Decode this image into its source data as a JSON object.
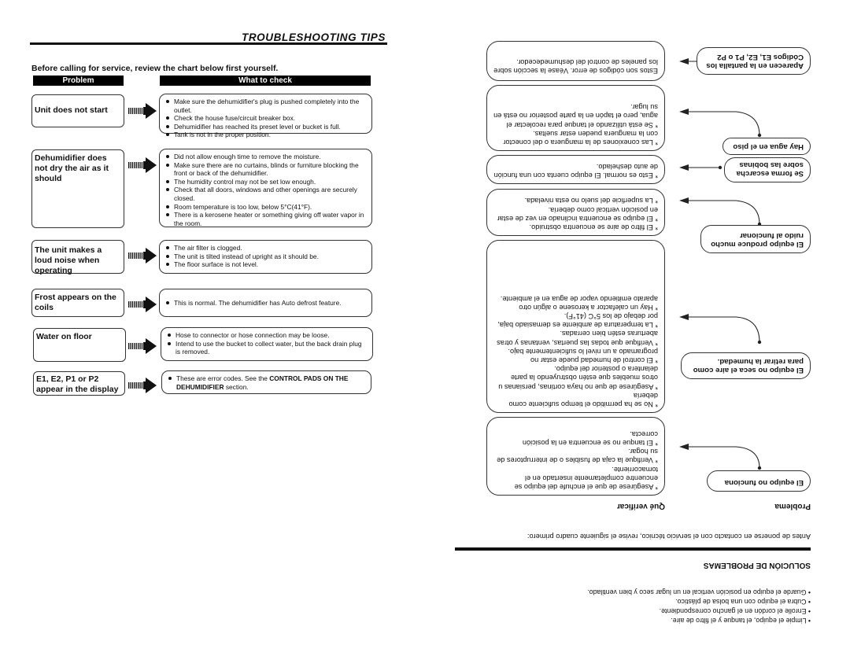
{
  "english_page": {
    "title": "TROUBLESHOOTING TIPS",
    "intro": "Before calling for service, review the chart below first yourself.",
    "headers": {
      "problem": "Problem",
      "check": "What to check"
    },
    "rows": [
      {
        "problem": "Unit does not start",
        "checks": [
          "Make sure the dehumidifier's plug is pushed completely into the outlet.",
          "Check  the house fuse/circuit breaker box.",
          "Dehumidifier has reached its preset level or bucket is full.",
          "Tank is not in the proper position."
        ]
      },
      {
        "problem": "Dehumidifier does not dry the air as it should",
        "checks": [
          "Did not allow enough time to remove the moisture.",
          "Make sure there are no curtains, blinds or furniture blocking the front or back of the dehumidifier.",
          "The humidity control may not be set low enough.",
          "Check that all doors, windows and other openings are securely closed.",
          "Room temperature is too low, below 5°C(41°F).",
          "There is a kerosene heater or something giving off water vapor in the room."
        ]
      },
      {
        "problem": "The unit makes a loud noise when operating",
        "checks": [
          "The air filter is clogged.",
          "The unit is tilted instead of upright as it should be.",
          "The floor surface is not level."
        ]
      },
      {
        "problem": "Frost appears on the coils",
        "checks": [
          "This is normal. The dehumidifier has Auto defrost feature."
        ]
      },
      {
        "problem": "Water on floor",
        "checks": [
          "Hose to connector or hose connection may be loose.",
          "Intend to use the bucket to collect water, but the back drain plug is  removed."
        ]
      },
      {
        "problem": "E1, E2, P1 or P2 appear in the display",
        "checks_rich": {
          "prefix": "These are error codes. See the ",
          "bold": "CONTROL PADS ON THE DEHUMIDIFIER",
          "suffix": " section."
        }
      }
    ]
  },
  "spanish_page": {
    "storage_bullets": [
      "Limpie el equipo, el tanque y el filtro de aire.",
      "Enrolle el cordón en el gancho correspondiente.",
      "Cubra el equipo con una bolsa de plástico.",
      "Guarde el equipo en posición vertical en un lugar seco y bien ventilado."
    ],
    "title": "SOLUCIÓN DE PROBLEMAS",
    "intro": "Antes de ponerse en contacto con el servicio técnico, revise el siguiente cuadro primero:",
    "headers": {
      "problem": "Problema",
      "check": "Qué verificar"
    },
    "rows": [
      {
        "problem": "El equipo no funciona",
        "checks": [
          "Asegúrese de que el enchufe del equipo se encuentre completamente insertado en el tomacorriente.",
          "Verifique la caja de fusibles o de interruptores de su hogar.",
          "El tanque no se encuentra en la posición correcta."
        ]
      },
      {
        "problem": "El equipo no seca el aire como para retirar la humedad.",
        "checks": [
          "No se ha permitido el tiempo suficiente como debería",
          "Asegúrese de que no haya cortinas, persianas u otros muebles que estén obstruyendo la parte delantera o posterior del equipo.",
          "El control de humedad puede estar no programado a un nivel lo suficientemente bajo.",
          "Verifique que todas las puertas, ventanas y otras aberturas estén bien cerradas.",
          "La temperatura de ambiente es demasiado baja, por debajo de los 5°C (41°F).",
          "Hay un calefactor a kerosene o algún otro aparato emitiendo vapor de agua en el ambiente."
        ]
      },
      {
        "problem": "El equipo produce mucho ruido al funcionar",
        "checks": [
          "El filtro de aire se encuentra obstruido.",
          "El equipo se encuentra inclinado en vez de estar en posición vertical como debería.",
          "La superficie del suelo no esta nivelada."
        ]
      },
      {
        "problem": "Se forma escarcha sobre las bobinas",
        "checks": [
          "Esto es normal. El equipo cuenta con una función de auto deshelado."
        ]
      },
      {
        "problem": "Hay agua en el piso",
        "checks": [
          "Las conexiones de la manguera o del conector con la manguera pueden estar sueltas.",
          "Se está utilizando el tanque para recolectar el agua, pero el tapón en la parte posterior no está en su lugar."
        ]
      },
      {
        "problem": "Aparecen en la pantalla los Códigos E1, E2, P1 o P2",
        "checks_plain": "Estos son códigos de error. Véase la sección sobre los paneles de control del deshumedecedor."
      }
    ]
  }
}
